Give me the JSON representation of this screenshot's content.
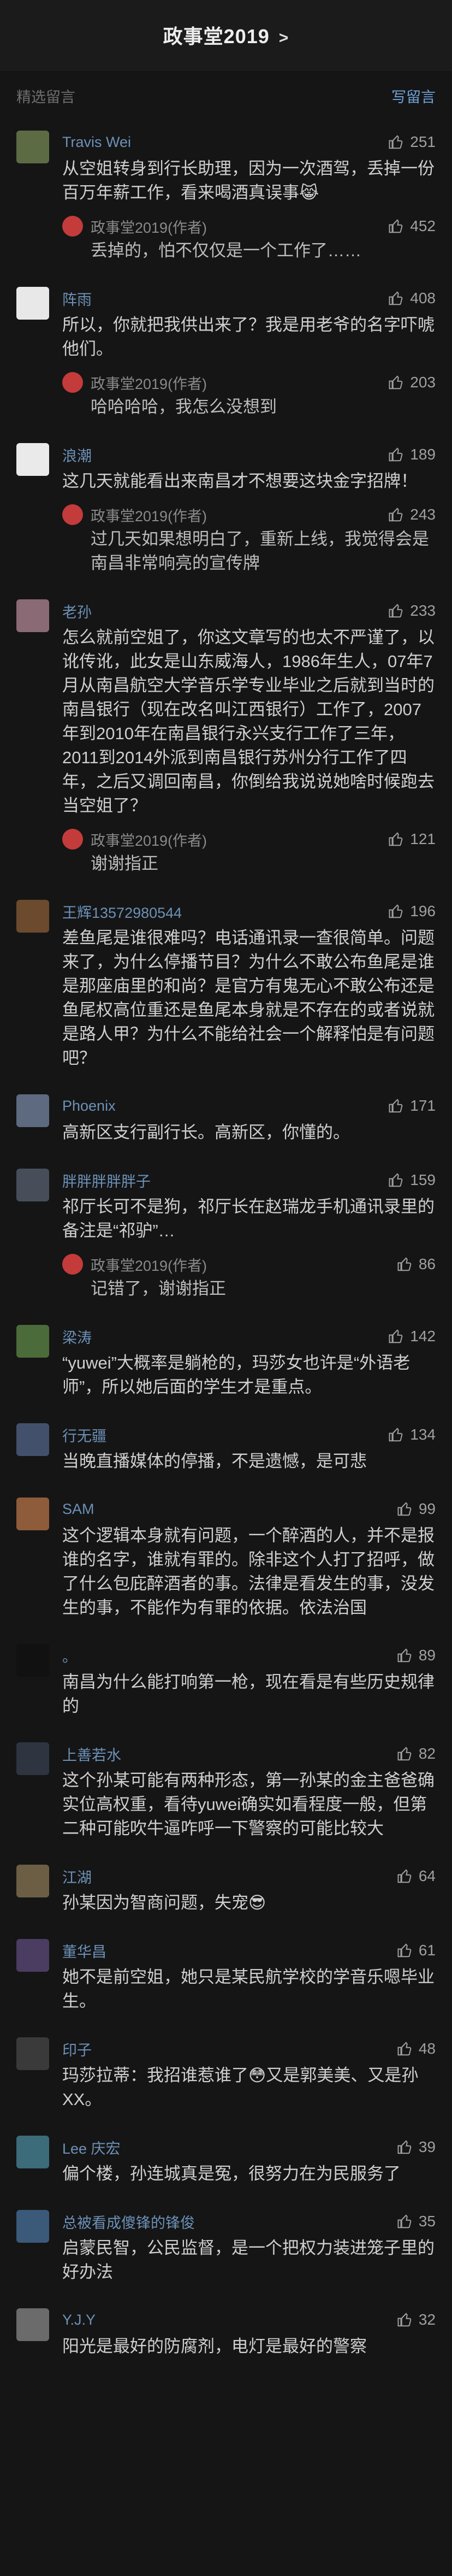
{
  "app": {
    "title": "政事堂2019",
    "title_chevron": ">",
    "section_label": "精选留言",
    "write_link": "写留言"
  },
  "comments": [
    {
      "name": "Travis Wei",
      "likes": "251",
      "text": "从空姐转身到行长助理，因为一次酒驾，丢掉一份百万年薪工作，看来喝酒真误事😹",
      "reply": {
        "author": "政事堂2019(作者)",
        "likes": "452",
        "text": "丢掉的，怕不仅仅是一个工作了……"
      }
    },
    {
      "name": "阵雨",
      "likes": "408",
      "text": "所以，你就把我供出来了？我是用老爷的名字吓唬他们。",
      "reply": {
        "author": "政事堂2019(作者)",
        "likes": "203",
        "text": "哈哈哈哈，我怎么没想到"
      }
    },
    {
      "name": "浪潮",
      "likes": "189",
      "text": "这几天就能看出来南昌才不想要这块金字招牌！",
      "reply": {
        "author": "政事堂2019(作者)",
        "likes": "243",
        "text": "过几天如果想明白了，重新上线，我觉得会是南昌非常响亮的宣传牌"
      }
    },
    {
      "name": "老孙",
      "likes": "233",
      "text": "怎么就前空姐了，你这文章写的也太不严谨了，以讹传讹，此女是山东威海人，1986年生人，07年7月从南昌航空大学音乐学专业毕业之后就到当时的南昌银行（现在改名叫江西银行）工作了，2007年到2010年在南昌银行永兴支行工作了三年，2011到2014外派到南昌银行苏州分行工作了四年，之后又调回南昌，你倒给我说说她啥时候跑去当空姐了？",
      "reply": {
        "author": "政事堂2019(作者)",
        "likes": "121",
        "text": "谢谢指正"
      }
    },
    {
      "name": "王辉13572980544",
      "likes": "196",
      "text": "差鱼尾是谁很难吗？电话通讯录一查很简单。问题来了，为什么停播节目？为什么不敢公布鱼尾是谁是那座庙里的和尚？是官方有鬼无心不敢公布还是鱼尾权高位重还是鱼尾本身就是不存在的或者说就是路人甲？为什么不能给社会一个解释怕是有问题吧？",
      "reply": null
    },
    {
      "name": "Phoenix",
      "likes": "171",
      "text": "高新区支行副行长。高新区，你懂的。",
      "reply": null
    },
    {
      "name": "胖胖胖胖胖子",
      "likes": "159",
      "text": "祁厅长可不是狗，祁厅长在赵瑞龙手机通讯录里的备注是“祁驴”…",
      "reply": {
        "author": "政事堂2019(作者)",
        "likes": "86",
        "text": "记错了，谢谢指正"
      }
    },
    {
      "name": "梁涛",
      "likes": "142",
      "text": "“yuwei”大概率是躺枪的，玛莎女也许是“外语老师”，所以她后面的学生才是重点。",
      "reply": null
    },
    {
      "name": "行无疆",
      "likes": "134",
      "text": "当晚直播媒体的停播，不是遗憾，是可悲",
      "reply": null
    },
    {
      "name": "SAM",
      "likes": "99",
      "text": "这个逻辑本身就有问题，一个醉酒的人，并不是报谁的名字，谁就有罪的。除非这个人打了招呼，做了什么包庇醉酒者的事。法律是看发生的事，没发生的事，不能作为有罪的依据。依法治国",
      "reply": null
    },
    {
      "name": "。",
      "likes": "89",
      "text": "南昌为什么能打响第一枪，现在看是有些历史规律的",
      "reply": null
    },
    {
      "name": "上善若水",
      "likes": "82",
      "text": "这个孙某可能有两种形态，第一孙某的金主爸爸确实位高权重，看待yuwei确实如看程度一般，但第二种可能吹牛逼咋呼一下警察的可能比较大",
      "reply": null
    },
    {
      "name": "江湖",
      "likes": "64",
      "text": "孙某因为智商问题，失宠😎",
      "reply": null
    },
    {
      "name": "董华昌",
      "likes": "61",
      "text": "她不是前空姐，她只是某民航学校的学音乐嗯毕业生。",
      "reply": null
    },
    {
      "name": "印子",
      "likes": "48",
      "text": "玛莎拉蒂：我招谁惹谁了😳又是郭美美、又是孙XX。",
      "reply": null
    },
    {
      "name": "Lee 庆宏",
      "likes": "39",
      "text": "偏个楼，孙连城真是冤，很努力在为民服务了",
      "reply": null
    },
    {
      "name": "总被看成傻锋的锋俊",
      "likes": "35",
      "text": "启蒙民智，公民监督，是一个把权力装进笼子里的好办法",
      "reply": null
    },
    {
      "name": "Y.J.Y",
      "likes": "32",
      "text": "阳光是最好的防腐剂，电灯是最好的警察",
      "reply": null
    }
  ]
}
